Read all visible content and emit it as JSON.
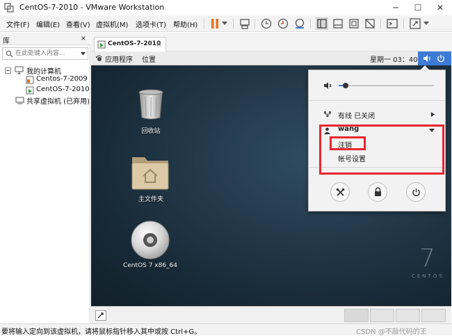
{
  "window": {
    "title": "CentOS-7-2010 - VMware Workstation"
  },
  "menubar": {
    "items": [
      "文件(F)",
      "编辑(E)",
      "查看(V)",
      "虚拟机(M)",
      "选项卡(T)",
      "帮助(H)"
    ]
  },
  "library": {
    "title": "库",
    "close": "×",
    "search_placeholder": "在此处键入内容...",
    "tree": {
      "root": "我的计算机",
      "vms": [
        "Centos-7-2009",
        "CentOS-7-2010"
      ],
      "shared": "共享虚拟机 (已弃用)"
    }
  },
  "tab": {
    "label": "CentOS-7-2010",
    "close": "×"
  },
  "guest": {
    "topbar": {
      "applications": "应用程序",
      "places": "位置",
      "clock": "星期一 03：40"
    },
    "desktop_icons": [
      {
        "label": "回收站",
        "icon": "trash-icon"
      },
      {
        "label": "主文件夹",
        "icon": "home-folder-icon"
      },
      {
        "label": "CentOS 7 x86_64",
        "icon": "disc-icon"
      }
    ],
    "watermark": {
      "number": "7",
      "text": "CENTOS"
    },
    "menu": {
      "volume_level": 0.05,
      "wired": "有线  已关闭",
      "user": "wang",
      "logout": "注销",
      "account_settings": "帐号设置"
    }
  },
  "statusbar": {
    "message": "要将输入定向到该虚拟机，请将鼠标指针移入其中或按 Ctrl+G。",
    "watermark": "CSDN @不敲代码的王"
  },
  "colors": {
    "accent": "#3d7bd6",
    "highlight": "#e8262f",
    "pause": "#e8731c"
  }
}
